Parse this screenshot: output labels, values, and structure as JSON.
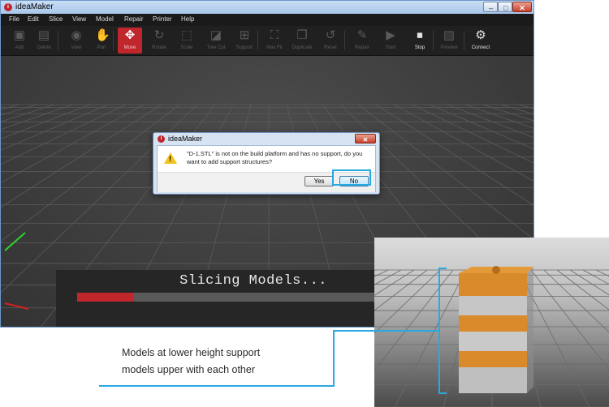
{
  "window": {
    "title": "ideaMaker",
    "logo_letter": "i",
    "controls": {
      "minimize": "–",
      "maximize": "□",
      "close": "✕"
    }
  },
  "menu": [
    "File",
    "Edit",
    "Slice",
    "View",
    "Model",
    "Repair",
    "Printer",
    "Help"
  ],
  "toolbar": {
    "items": [
      {
        "label": "Add",
        "icon": "add-icon",
        "glyph": "▣",
        "state": "dim"
      },
      {
        "label": "Delete",
        "icon": "delete-icon",
        "glyph": "▤",
        "state": "dim"
      },
      {
        "label": "View",
        "icon": "eye-icon",
        "glyph": "◉",
        "state": "dim"
      },
      {
        "label": "Pan",
        "icon": "hand-icon",
        "glyph": "✋",
        "state": "dim"
      },
      {
        "label": "Move",
        "icon": "move-icon",
        "glyph": "✥",
        "state": "active"
      },
      {
        "label": "Rotate",
        "icon": "rotate-icon",
        "glyph": "↻",
        "state": "dim"
      },
      {
        "label": "Scale",
        "icon": "scale-icon",
        "glyph": "⬚",
        "state": "dim"
      },
      {
        "label": "Tree Cut",
        "icon": "cut-icon",
        "glyph": "◪",
        "state": "dim"
      },
      {
        "label": "Support",
        "icon": "support-icon",
        "glyph": "⊞",
        "state": "dim"
      },
      {
        "label": "Max Fit",
        "icon": "max-fit-icon",
        "glyph": "⛶",
        "state": "dim"
      },
      {
        "label": "Duplicate",
        "icon": "duplicate-icon",
        "glyph": "❐",
        "state": "dim"
      },
      {
        "label": "Reset",
        "icon": "reset-icon",
        "glyph": "↺",
        "state": "dim"
      },
      {
        "label": "Repair",
        "icon": "repair-icon",
        "glyph": "✎",
        "state": "dim"
      },
      {
        "label": "Start",
        "icon": "play-icon",
        "glyph": "▶",
        "state": "dim"
      },
      {
        "label": "Stop",
        "icon": "stop-icon",
        "glyph": "⏹",
        "state": "bright"
      },
      {
        "label": "Preview",
        "icon": "preview-icon",
        "glyph": "▨",
        "state": "dim"
      },
      {
        "label": "Connect",
        "icon": "connect-icon",
        "glyph": "⚙",
        "state": "bright"
      }
    ]
  },
  "dialog": {
    "title": "ideaMaker",
    "close_glyph": "✕",
    "icon": "warning-icon",
    "message": "\"D-1.STL\" is not on the build platform and has no support, do you want to add support structures?",
    "yes_label": "Yes",
    "no_label": "No"
  },
  "slicing": {
    "text": "Slicing Models...",
    "progress": 0.19
  },
  "caption": {
    "line1": "Models at lower height support",
    "line2": "models upper with each other"
  },
  "colors": {
    "accent_red": "#c0272d",
    "highlight_blue": "#2aa9e0",
    "orange_block": "#d98a2b",
    "gray_block": "#c8c8c8"
  }
}
